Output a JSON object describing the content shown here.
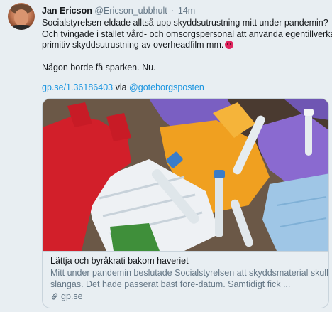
{
  "author": {
    "name": "Jan Ericson",
    "handle": "@Ericson_ubbhult",
    "separator": "·",
    "time": "14m"
  },
  "tweet": {
    "line1": "Socialstyrelsen eldade alltså upp skyddsutrustning mitt under pandemin?",
    "line2": "Och tvingade i stället vård- och omsorgspersonal att använda egentillverkad",
    "line3": "primitiv skyddsutrustning av overheadfilm mm.",
    "emoji": "angry-face-icon",
    "line4": "Någon borde få sparken. Nu.",
    "link": "gp.se/1.36186403",
    "via": "via",
    "mention": "@goteborgsposten"
  },
  "card": {
    "image_alt": "protective equipment pile",
    "title": "Lättja och byråkrati bakom haveriet",
    "desc_line1": "Mitt under pandemin beslutade Socialstyrelsen att skyddsmaterial skulle",
    "desc_line2": "slängas. Det hade passerat bäst före-datum. Samtidigt fick ...",
    "domain": "gp.se"
  },
  "colors": {
    "link": "#1b95e0",
    "secondary_text": "#657786",
    "background": "#e8eef2"
  }
}
